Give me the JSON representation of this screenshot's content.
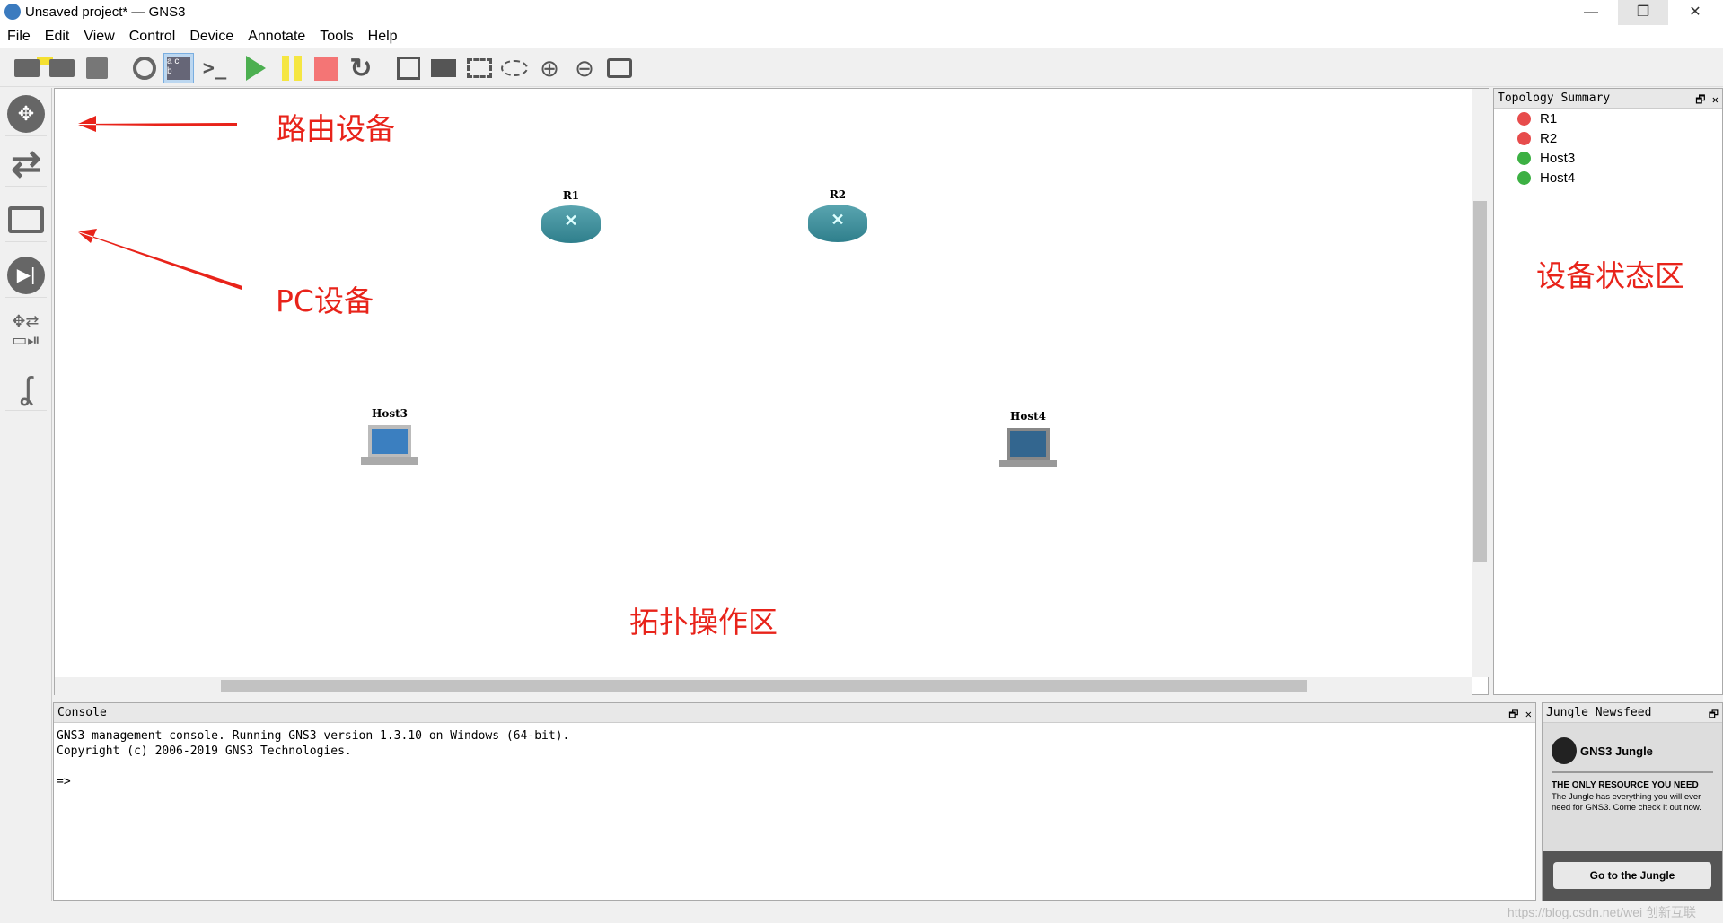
{
  "window": {
    "title": "Unsaved project* — GNS3"
  },
  "menu": [
    "File",
    "Edit",
    "View",
    "Control",
    "Device",
    "Annotate",
    "Tools",
    "Help"
  ],
  "toolbar": [
    "open-project-icon",
    "open-folder-icon",
    "snapshot-icon",
    "clock-icon",
    "show-interface-labels-icon",
    "console-icon",
    "start-icon",
    "pause-icon",
    "stop-icon",
    "reload-icon",
    "note-icon",
    "image-icon",
    "rectangle-icon",
    "ellipse-icon",
    "zoom-in-icon",
    "zoom-out-icon",
    "screenshot-icon"
  ],
  "colors": {
    "start": "#4caf50",
    "pause": "#f5e642",
    "stop": "#f47575",
    "annotation": "#e8231a",
    "status_stopped": "#e74c4c",
    "status_started": "#3cb043"
  },
  "nodes": [
    {
      "name": "R1",
      "type": "router"
    },
    {
      "name": "R2",
      "type": "router"
    },
    {
      "name": "Host3",
      "type": "host"
    },
    {
      "name": "Host4",
      "type": "host"
    }
  ],
  "annotations": {
    "router": "路由设备",
    "pc": "PC设备",
    "status_area": "设备状态区",
    "topology_area": "拓扑操作区"
  },
  "topology": {
    "title": "Topology Summary",
    "items": [
      {
        "name": "R1",
        "status": "stopped"
      },
      {
        "name": "R2",
        "status": "stopped"
      },
      {
        "name": "Host3",
        "status": "started"
      },
      {
        "name": "Host4",
        "status": "started"
      }
    ]
  },
  "console": {
    "title": "Console",
    "text": "GNS3 management console. Running GNS3 version 1.3.10 on Windows (64-bit).\nCopyright (c) 2006-2019 GNS3 Technologies.\n\n=>"
  },
  "jungle": {
    "title": "Jungle Newsfeed",
    "logo": "GNS3 Jungle",
    "headline": "THE ONLY RESOURCE YOU NEED",
    "body": "The Jungle has everything you will ever need for GNS3. Come check it out now.",
    "button": "Go to the Jungle"
  },
  "watermark": "https://blog.csdn.net/wei  创新互联"
}
